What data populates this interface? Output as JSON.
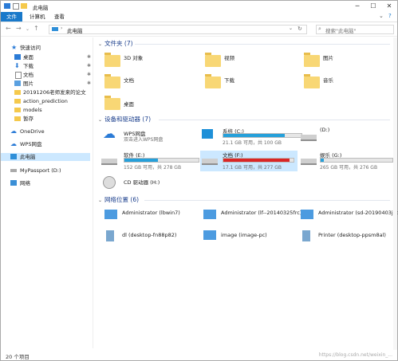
{
  "title": "此电脑",
  "ribbon": {
    "tabs": [
      "文件",
      "计算机",
      "查看"
    ]
  },
  "address": {
    "path": "此电脑",
    "search_placeholder": "搜索\"此电脑\""
  },
  "sidebar": {
    "items": [
      {
        "label": "快速访问",
        "icon": "star-icon"
      },
      {
        "label": "桌面",
        "icon": "desktop-folder-icon",
        "pinned": true
      },
      {
        "label": "下载",
        "icon": "download-icon",
        "pinned": true
      },
      {
        "label": "文档",
        "icon": "document-icon",
        "pinned": true
      },
      {
        "label": "图片",
        "icon": "picture-icon",
        "pinned": true
      },
      {
        "label": "20191206老师发来的论文",
        "icon": "folder-icon"
      },
      {
        "label": "action_prediction",
        "icon": "folder-icon"
      },
      {
        "label": "models",
        "icon": "folder-icon"
      },
      {
        "label": "暂存",
        "icon": "folder-icon"
      },
      {
        "label": "OneDrive",
        "icon": "cloud-icon"
      },
      {
        "label": "WPS网盘",
        "icon": "cloud-icon"
      },
      {
        "label": "此电脑",
        "icon": "computer-icon",
        "selected": true
      },
      {
        "label": "MyPassport (D:)",
        "icon": "drive-icon"
      },
      {
        "label": "网络",
        "icon": "network-icon"
      }
    ]
  },
  "folders": {
    "header": "文件夹 (7)",
    "items": [
      {
        "label": "3D 对象"
      },
      {
        "label": "视频"
      },
      {
        "label": "图片"
      },
      {
        "label": "文档"
      },
      {
        "label": "下载"
      },
      {
        "label": "音乐"
      },
      {
        "label": "桌面"
      }
    ]
  },
  "devices": {
    "header": "设备和驱动器 (7)",
    "items": [
      {
        "label": "WPS网盘",
        "sub": "双击进入WPS网盘"
      },
      {
        "label": "系统 (C:)",
        "sub": "21.1 GB 可用，共 100 GB",
        "used_fraction": 0.79
      },
      {
        "label": "(D:)",
        "sub": ""
      },
      {
        "label": "软件 (E:)",
        "sub": "152 GB 可用，共 278 GB",
        "used_fraction": 0.45
      },
      {
        "label": "文档 (F:)",
        "sub": "17.1 GB 可用，共 277 GB",
        "used_fraction": 0.94
      },
      {
        "label": "娱乐 (G:)",
        "sub": "265 GB 可用，共 276 GB",
        "used_fraction": 0.04
      },
      {
        "label": "CD 驱动器 (H:)",
        "sub": ""
      }
    ]
  },
  "network": {
    "header": "网络位置 (6)",
    "items": [
      {
        "label": "Administrator (lbwin7)"
      },
      {
        "label": "Administrator (lf--20140325frc)"
      },
      {
        "label": "Administrator (sd-20190403jeb)"
      },
      {
        "label": "dl (desktop-fn88p82)"
      },
      {
        "label": "image (image-pc)"
      },
      {
        "label": "Printer (desktop-ppsm8al)"
      }
    ]
  },
  "status": {
    "count": "20 个项目"
  },
  "watermark": "https://blog.csdn.net/weixin_..."
}
